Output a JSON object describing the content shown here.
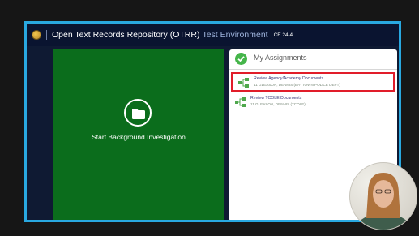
{
  "header": {
    "title": "Open Text Records Repository (OTRR)",
    "environment": "Test Environment",
    "version": "CE 24.4"
  },
  "left_panel": {
    "label": "Start Background Investigation",
    "bg_color": "#0b6d1c"
  },
  "assignments": {
    "title": "My Assignments",
    "items": [
      {
        "title": "Review Agency/Academy Documents",
        "subtitle": "11 GLEASON, DENNIS (BAYTOWN POLICE DEPT)",
        "highlighted": true
      },
      {
        "title": "Review TCOLE Documents",
        "subtitle": "11 GLEASON, DENNIS (TCOLE)",
        "highlighted": false
      }
    ]
  },
  "colors": {
    "frame_border": "#29a8e0",
    "highlight_border": "#e11d2a",
    "header_bg": "#0a1430",
    "check": "#45b54a"
  },
  "icons": [
    "logo-icon",
    "folder-icon",
    "check-icon",
    "tree-icon"
  ]
}
